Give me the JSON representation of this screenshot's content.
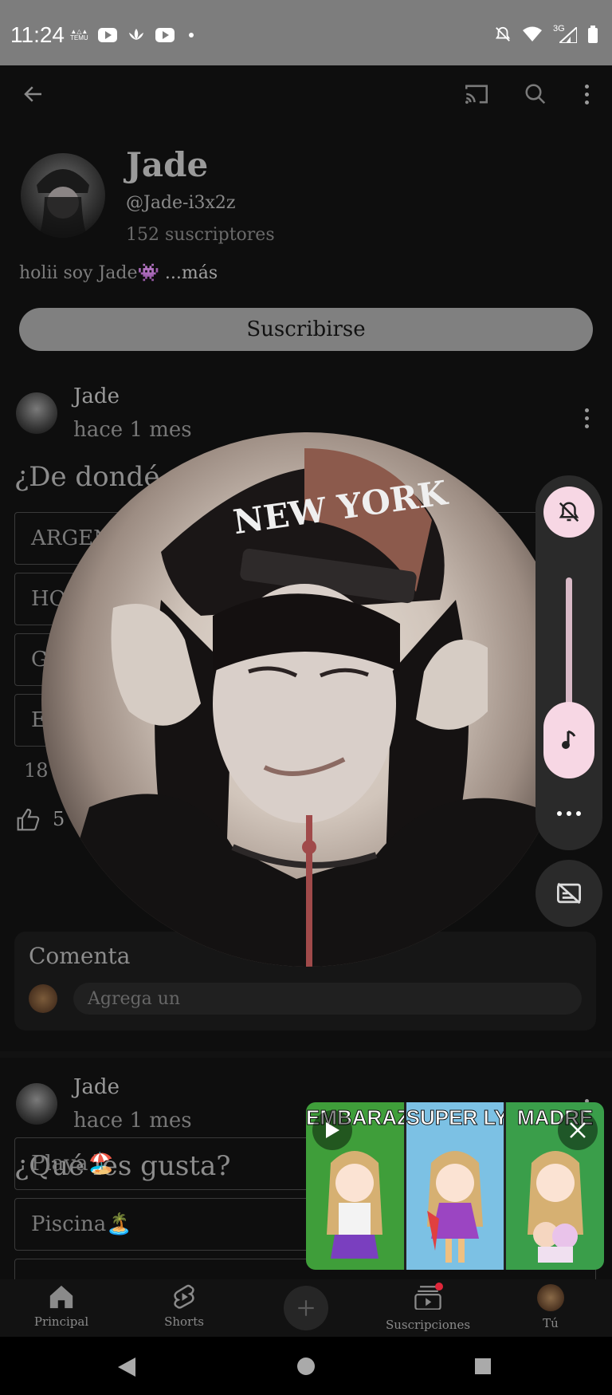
{
  "status_bar": {
    "time": "11:24",
    "network": "3G",
    "temu_label": "TEMU"
  },
  "channel": {
    "name": "Jade",
    "handle": "@Jade-i3x2z",
    "subscribers": "152 suscriptores",
    "bio": "holii soy Jade👾",
    "bio_more": "...más",
    "subscribe_label": "Suscribirse"
  },
  "post1": {
    "author": "Jade",
    "time": "hace 1 mes",
    "question": "¿De dondé",
    "options": [
      "ARGEN",
      "HO",
      "G",
      "E"
    ],
    "votes": "18",
    "likes": "5",
    "comments_title": "Comenta",
    "comment_placeholder": "Agrega un"
  },
  "post2": {
    "author": "Jade",
    "time": "hace 1 mes",
    "question": "¿Qué les gusta?",
    "options": [
      "Playa🏖️",
      "Piscina🏝️"
    ]
  },
  "mini_player": {
    "panels": [
      "EMBARAZADA",
      "SUPER LYNA",
      "MADRE"
    ]
  },
  "bottom_nav": {
    "items": [
      {
        "label": "Principal",
        "icon": "home-icon"
      },
      {
        "label": "Shorts",
        "icon": "shorts-icon"
      },
      {
        "label": "",
        "icon": "create-icon"
      },
      {
        "label": "Suscripciones",
        "icon": "subscriptions-icon"
      },
      {
        "label": "Tú",
        "icon": "avatar"
      }
    ]
  },
  "colors": {
    "accent_pink": "#f7d7e4",
    "notification_red": "#e0263a",
    "status_bar": "#7d7d7d"
  }
}
